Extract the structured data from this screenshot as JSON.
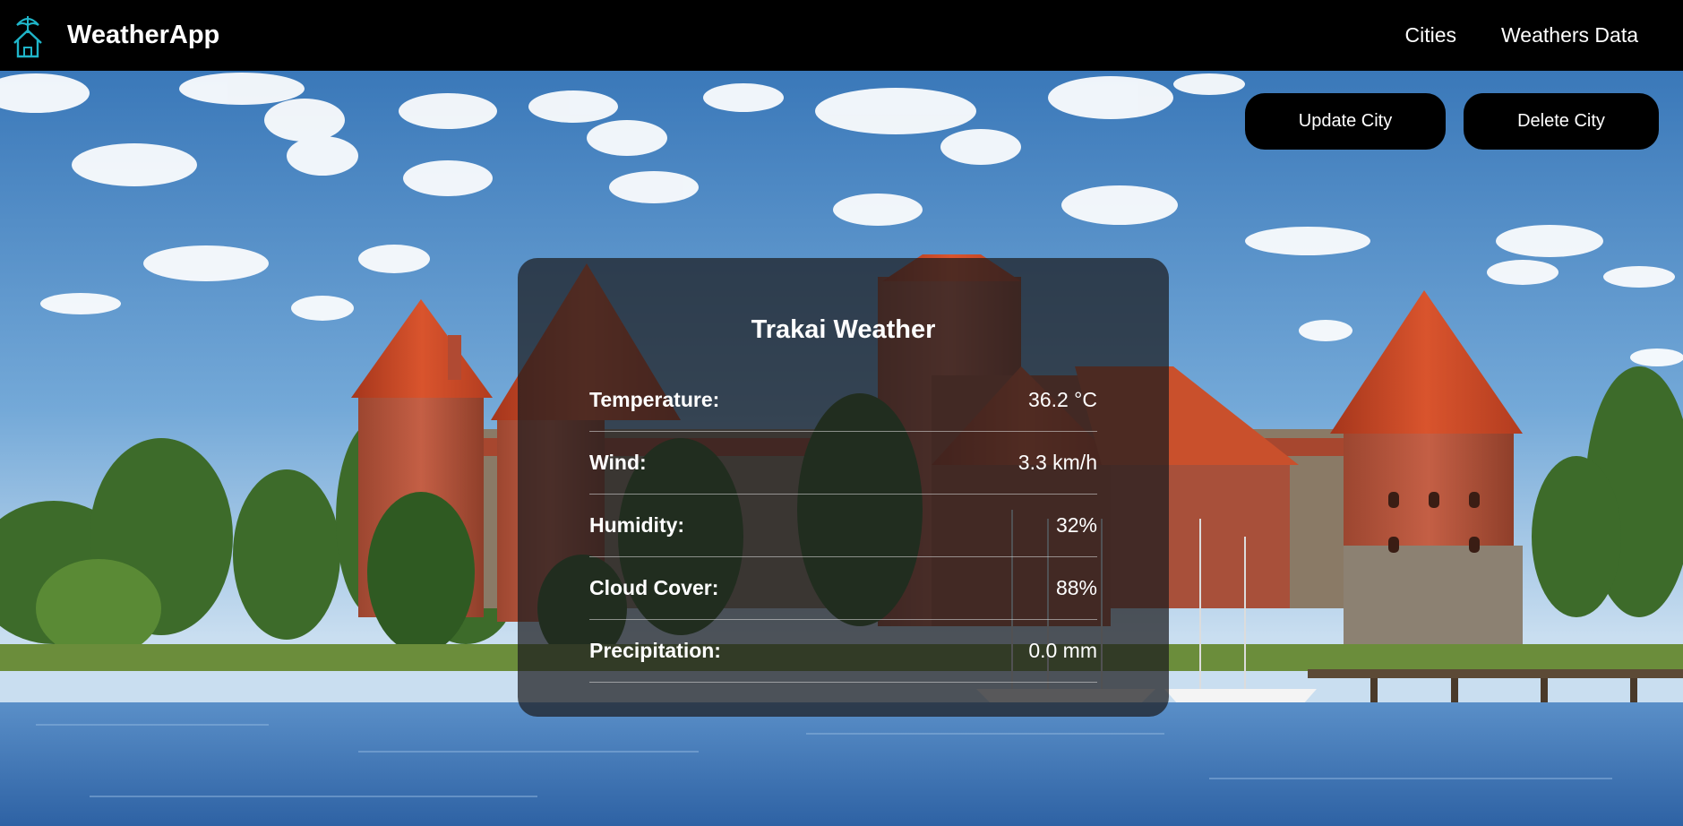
{
  "app": {
    "name": "WeatherApp",
    "icon": "umbrella-house-icon"
  },
  "nav": {
    "cities": "Cities",
    "weathers_data": "Weathers Data"
  },
  "actions": {
    "update": "Update City",
    "delete": "Delete City"
  },
  "weather": {
    "title": "Trakai Weather",
    "rows": [
      {
        "label": "Temperature:",
        "value": "36.2 °C"
      },
      {
        "label": "Wind:",
        "value": "3.3 km/h"
      },
      {
        "label": "Humidity:",
        "value": "32%"
      },
      {
        "label": "Cloud Cover:",
        "value": "88%"
      },
      {
        "label": "Precipitation:",
        "value": "0.0 mm"
      }
    ]
  },
  "colors": {
    "accent": "#1fb5c9",
    "navbar": "#000000",
    "card": "#1c1c1e"
  }
}
